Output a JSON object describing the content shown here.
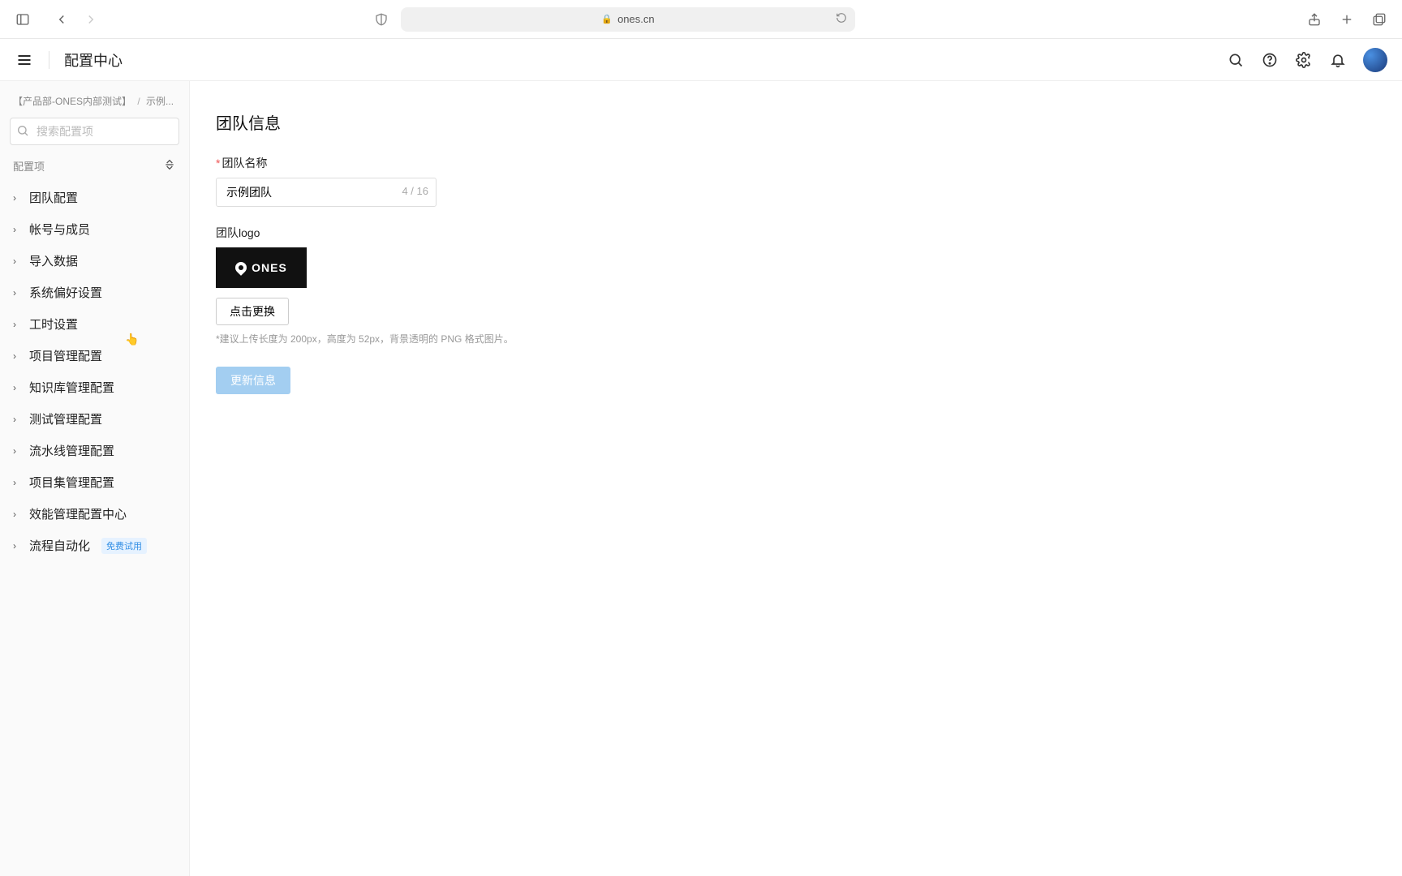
{
  "browser": {
    "url_host": "ones.cn"
  },
  "header": {
    "title": "配置中心"
  },
  "sidebar": {
    "breadcrumb": {
      "a": "【产品部-ONES内部测试】",
      "b": "示例..."
    },
    "search_placeholder": "搜索配置项",
    "section_label": "配置项",
    "items": [
      {
        "label": "团队配置"
      },
      {
        "label": "帐号与成员"
      },
      {
        "label": "导入数据"
      },
      {
        "label": "系统偏好设置"
      },
      {
        "label": "工时设置"
      },
      {
        "label": "项目管理配置"
      },
      {
        "label": "知识库管理配置"
      },
      {
        "label": "测试管理配置"
      },
      {
        "label": "流水线管理配置"
      },
      {
        "label": "项目集管理配置"
      },
      {
        "label": "效能管理配置中心"
      },
      {
        "label": "流程自动化",
        "badge": "免费试用"
      }
    ]
  },
  "main": {
    "page_title": "团队信息",
    "team_name_label": "团队名称",
    "team_name_value": "示例团队",
    "team_name_count": "4 / 16",
    "logo_label": "团队logo",
    "logo_text": "ONES",
    "change_logo_btn": "点击更换",
    "hint": "*建议上传长度为 200px，高度为 52px，背景透明的 PNG 格式图片。",
    "submit": "更新信息"
  }
}
